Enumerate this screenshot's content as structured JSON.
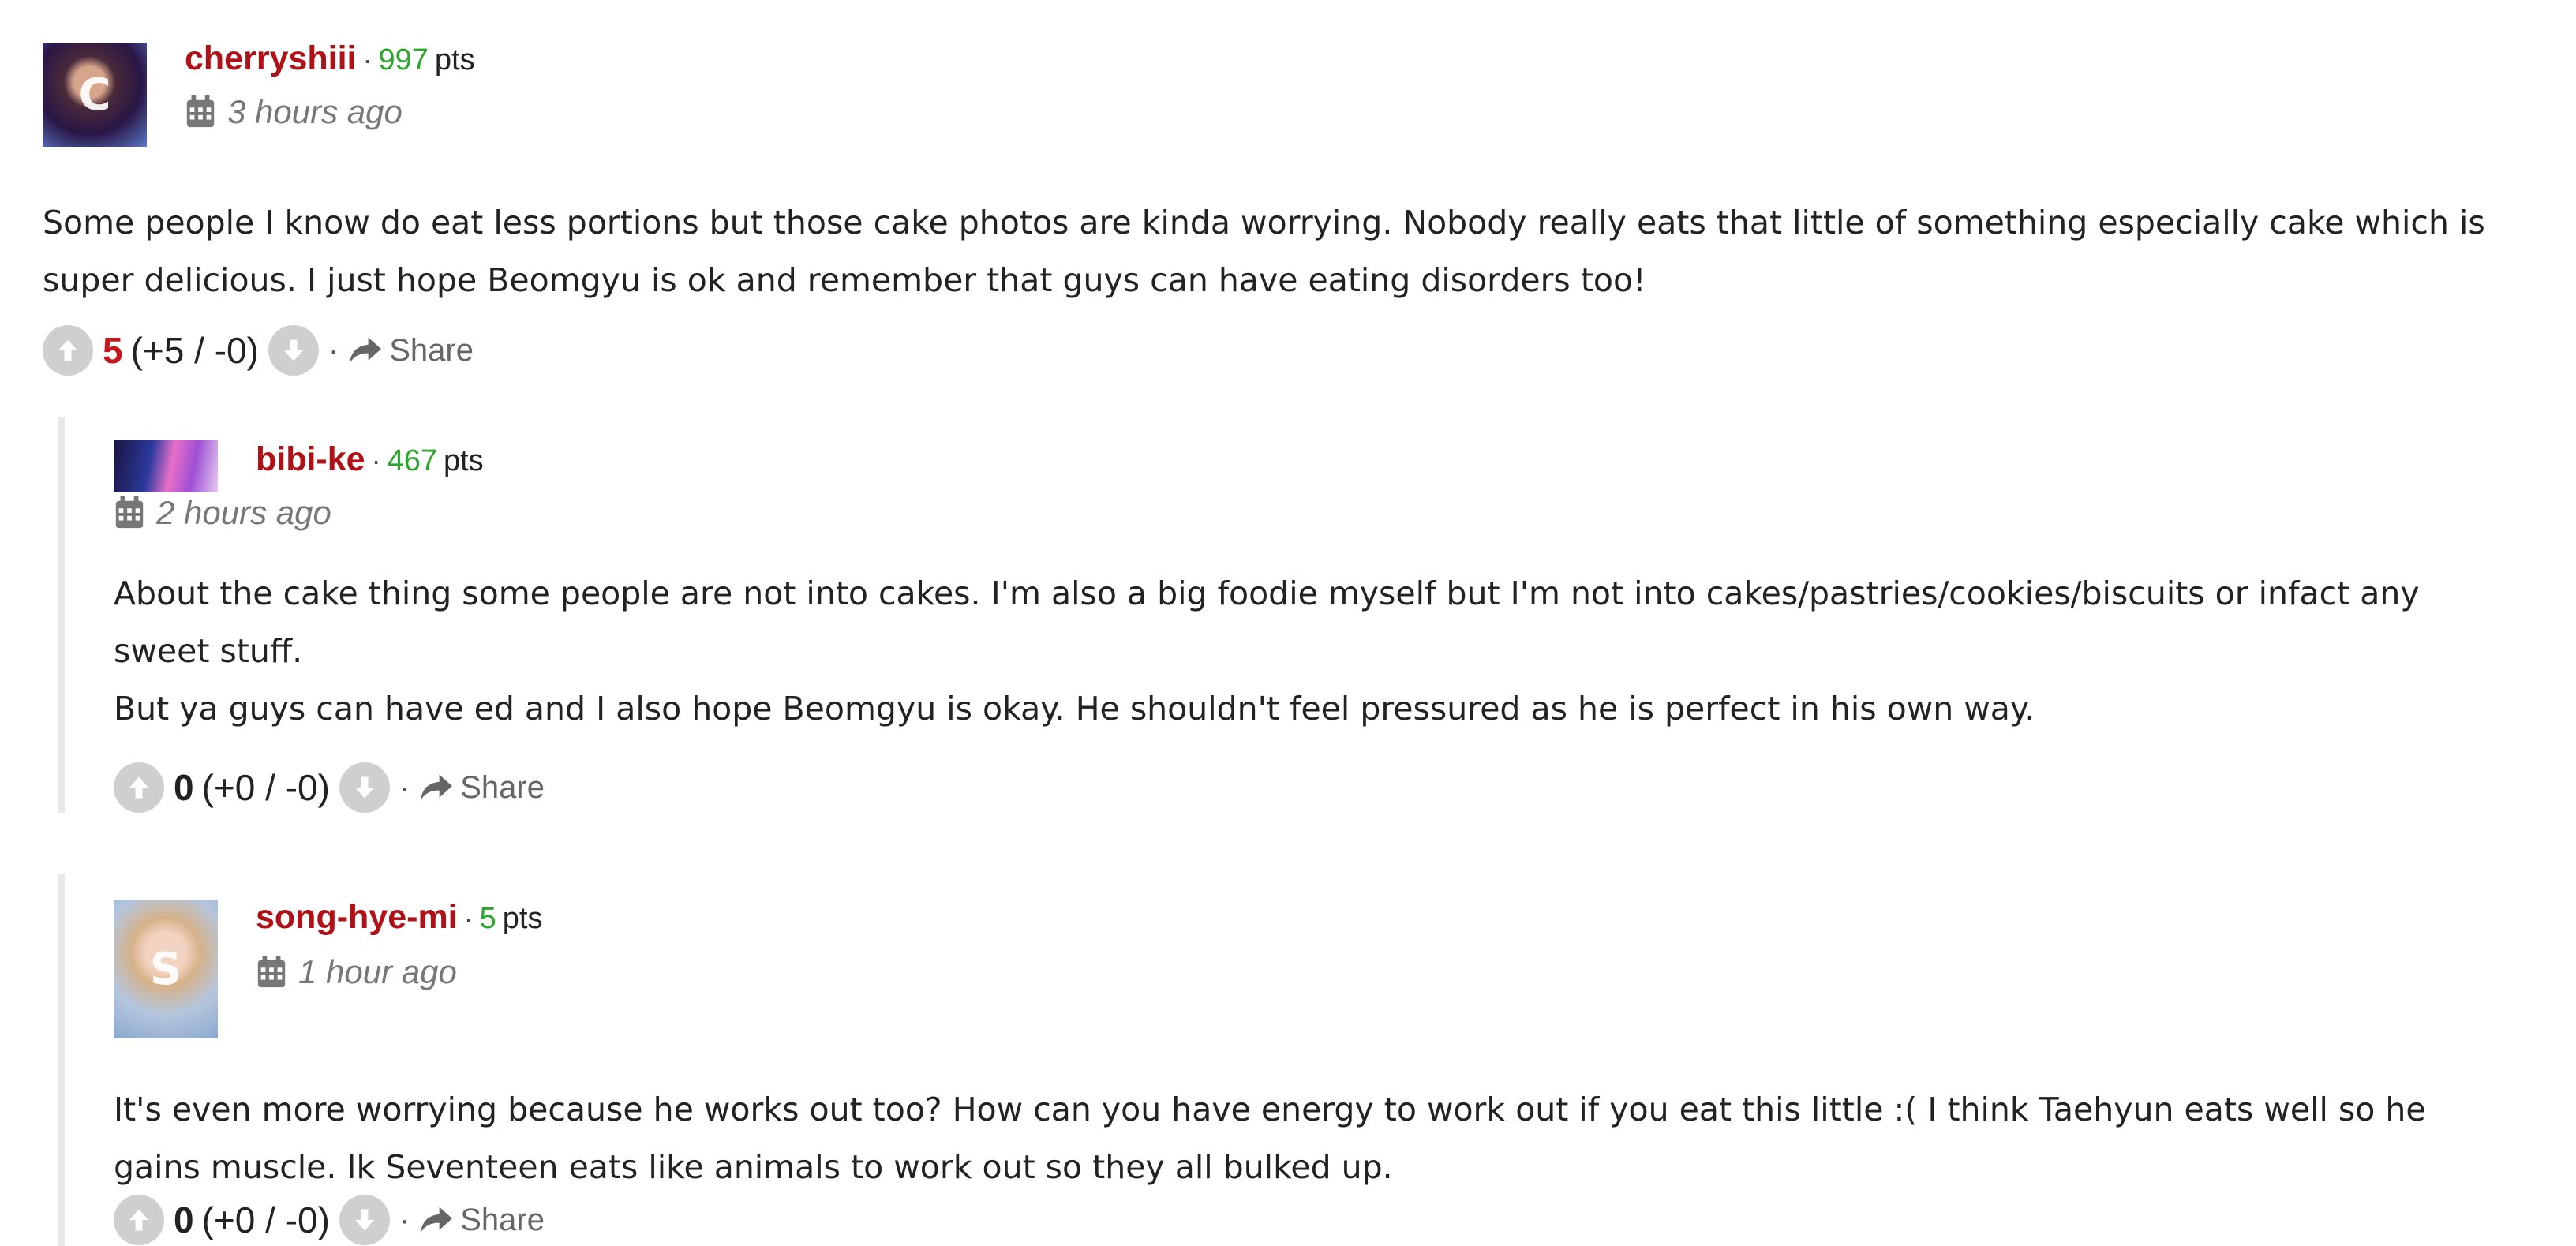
{
  "comments": [
    {
      "avatar_icon": "user-avatar",
      "username": "cherryshiii",
      "separator": "·",
      "points": "997",
      "points_label": "pts",
      "time": "3 hours ago",
      "text": [
        "Some people I know do eat less portions but those cake photos are kinda worrying. Nobody really eats that little of something especially cake which is super delicious. I just hope Beomgyu is ok and remember that guys can have eating disorders too!"
      ],
      "score": "5",
      "breakdown": "(+5 / -0)",
      "share_label": "Share"
    },
    {
      "avatar_icon": "user-avatar",
      "username": "bibi-ke",
      "separator": "·",
      "points": "467",
      "points_label": "pts",
      "time": "2 hours ago",
      "text": [
        "About the cake thing some people are not into cakes. I'm also a big foodie myself but I'm not into cakes/pastries/cookies/biscuits or infact any sweet stuff.",
        "But ya guys can have ed and I also hope Beomgyu is okay. He shouldn't feel pressured as he is perfect in his own way."
      ],
      "score": "0",
      "breakdown": "(+0 / -0)",
      "share_label": "Share"
    },
    {
      "avatar_icon": "user-avatar",
      "username": "song-hye-mi",
      "separator": "·",
      "points": "5",
      "points_label": "pts",
      "time": "1 hour ago",
      "text": [
        "It's even more worrying because he works out too? How can you have energy to work out if you eat this little :( I think Taehyun eats well so he gains muscle. Ik Seventeen eats like animals to work out so they all bulked up."
      ],
      "score": "0",
      "breakdown": "(+0 / -0)",
      "share_label": "Share"
    }
  ],
  "icons": {
    "calendar": "calendar-icon",
    "upvote": "upvote-arrow-icon",
    "downvote": "downvote-arrow-icon",
    "share": "share-arrow-icon"
  },
  "colors": {
    "username": "#b01117",
    "points": "#2fa52f",
    "positive_score": "#c8161d",
    "timestamp": "#777777",
    "vote_button": "#cfcfcf",
    "reply_border": "#e9e9e9"
  }
}
